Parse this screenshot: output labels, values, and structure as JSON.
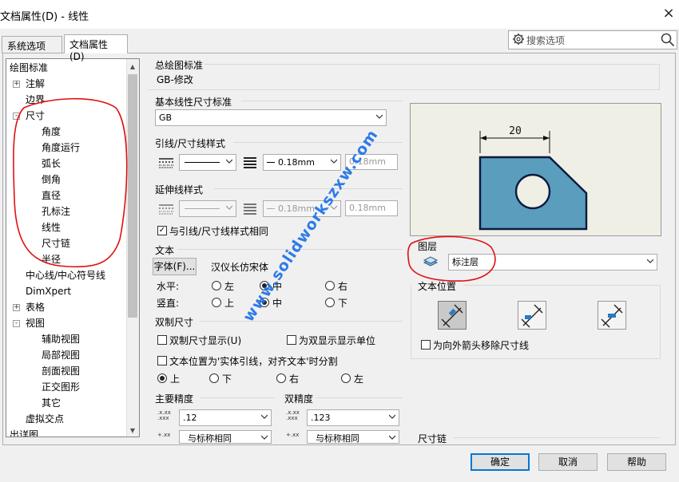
{
  "window": {
    "title": "文档属性(D) - 线性",
    "close": "×"
  },
  "tabs": [
    {
      "label": "系统选项(S)"
    },
    {
      "label": "文档属性(D)"
    }
  ],
  "search": {
    "placeholder": "搜索选项"
  },
  "tree": {
    "items": [
      {
        "label": "绘图标准",
        "indent": 0,
        "expander": ""
      },
      {
        "label": "注解",
        "indent": 1,
        "expander": "+"
      },
      {
        "label": "边界",
        "indent": 1,
        "expander": ""
      },
      {
        "label": "尺寸",
        "indent": 1,
        "expander": "-"
      },
      {
        "label": "角度",
        "indent": 2,
        "expander": ""
      },
      {
        "label": "角度运行",
        "indent": 2,
        "expander": ""
      },
      {
        "label": "弧长",
        "indent": 2,
        "expander": ""
      },
      {
        "label": "倒角",
        "indent": 2,
        "expander": ""
      },
      {
        "label": "直径",
        "indent": 2,
        "expander": ""
      },
      {
        "label": "孔标注",
        "indent": 2,
        "expander": ""
      },
      {
        "label": "线性",
        "indent": 2,
        "expander": ""
      },
      {
        "label": "尺寸链",
        "indent": 2,
        "expander": ""
      },
      {
        "label": "半径",
        "indent": 2,
        "expander": ""
      },
      {
        "label": "中心线/中心符号线",
        "indent": 1,
        "expander": ""
      },
      {
        "label": "DimXpert",
        "indent": 1,
        "expander": ""
      },
      {
        "label": "表格",
        "indent": 1,
        "expander": "+"
      },
      {
        "label": "视图",
        "indent": 1,
        "expander": "-"
      },
      {
        "label": "辅助视图",
        "indent": 2,
        "expander": ""
      },
      {
        "label": "局部视图",
        "indent": 2,
        "expander": ""
      },
      {
        "label": "剖面视图",
        "indent": 2,
        "expander": ""
      },
      {
        "label": "正交图形",
        "indent": 2,
        "expander": ""
      },
      {
        "label": "其它",
        "indent": 2,
        "expander": ""
      },
      {
        "label": "虚拟交点",
        "indent": 1,
        "expander": ""
      },
      {
        "label": "出详图",
        "indent": 0,
        "expander": ""
      }
    ]
  },
  "overall": {
    "label": "总绘图标准",
    "value": "GB-修改"
  },
  "base_std": {
    "label": "基本线性尺寸标准",
    "value": "GB"
  },
  "leader": {
    "label": "引线/尺寸线样式",
    "thickness": "0.18mm",
    "custom": "0.18mm"
  },
  "ext": {
    "label": "延伸线样式",
    "thickness": "0.18mm",
    "custom": "0.18mm",
    "same_label": "与引线/尺寸线样式相同",
    "same_checked": "✓"
  },
  "text": {
    "label": "文本",
    "font_button": "字体(F)...",
    "font_name": "汉仪长仿宋体",
    "horiz_label": "水平:",
    "vert_label": "竖直:",
    "left": "左",
    "center": "中",
    "right": "右",
    "top": "上",
    "middle": "中",
    "bottom": "下"
  },
  "dual": {
    "label": "双制尺寸",
    "show": "双制尺寸显示(U)",
    "top_units": "为双显示显示单位",
    "text_pos": "文本位置为'实体引线，对齐文本'时分割",
    "up": "上",
    "down": "下",
    "right": "右",
    "left": "左"
  },
  "primary": {
    "label": "主要精度",
    "value1": ".12",
    "value2": "与标称相同"
  },
  "dual_prec": {
    "label": "双精度",
    "value1": ".123",
    "value2": "与标称相同"
  },
  "preview": {
    "dim": "20"
  },
  "layer": {
    "label": "图层",
    "value": "标注层"
  },
  "textpos": {
    "label": "文本位置",
    "remove": "为向外箭头移除尺寸线"
  },
  "dimchain": {
    "label": "尺寸链"
  },
  "buttons": {
    "ok": "确定",
    "cancel": "取消",
    "help": "帮助"
  },
  "watermark": "www.solidworkszxw.com",
  "colors": {
    "part_fill": "#5a9dbd",
    "part_stroke": "#0a1a40",
    "annotation": "#e01010",
    "accent": "#0078d7"
  }
}
